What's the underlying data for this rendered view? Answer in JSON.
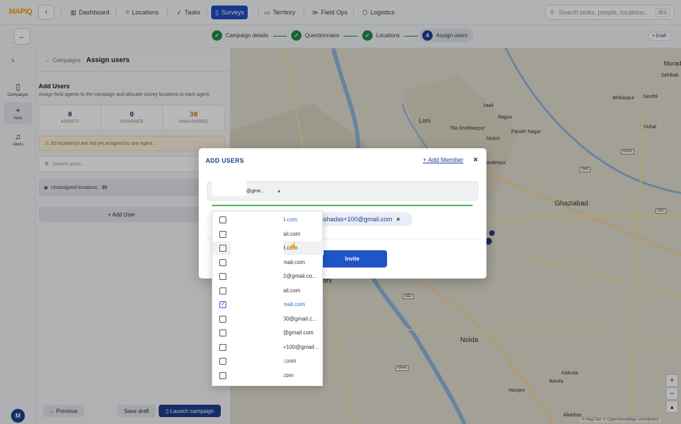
{
  "app": {
    "logo_main": "MAP",
    "logo_accent": "IQ"
  },
  "nav": {
    "items": [
      {
        "label": "Dashboard",
        "icon": "bar-chart-icon"
      },
      {
        "label": "Locations",
        "icon": "pin-icon"
      },
      {
        "label": "Tasks",
        "icon": "check-icon"
      },
      {
        "label": "Surveys",
        "icon": "clipboard-icon",
        "active": true
      },
      {
        "label": "Territory",
        "icon": "map-icon"
      },
      {
        "label": "Field Ops",
        "icon": "route-icon"
      },
      {
        "label": "Logistics",
        "icon": "box-icon"
      }
    ],
    "search_placeholder": "Search tasks, people, locations...",
    "search_shortcut": "⌘K"
  },
  "stepper": {
    "steps": [
      {
        "label": "Campaign details",
        "state": "done",
        "marker": "✓"
      },
      {
        "label": "Questionnaire",
        "state": "done",
        "marker": "✓"
      },
      {
        "label": "Locations",
        "state": "done",
        "marker": "✓"
      },
      {
        "label": "Assign users",
        "state": "current",
        "marker": "4"
      }
    ],
    "status_badge": "• Draft"
  },
  "rail": {
    "items": [
      {
        "label": "Campaigns",
        "icon": "clipboard-icon"
      },
      {
        "label": "New",
        "icon": "plus-icon"
      },
      {
        "label": "Alerts",
        "icon": "bell-icon"
      }
    ],
    "avatar": "M"
  },
  "panel": {
    "breadcrumb": "← Campaigns",
    "title": "Assign users",
    "section_title": "Add Users",
    "section_subtitle": "Assign field agents to the campaign and allocate survey locations to each agent.",
    "stats": [
      {
        "value": "0",
        "label": "AGENTS"
      },
      {
        "value": "0",
        "label": "ASSIGNED"
      },
      {
        "value": "30",
        "label": "UNASSIGNED"
      }
    ],
    "warning": "⚠ 30 location(s) are not yet assigned to any agent.",
    "user_search_placeholder": "Search users...",
    "unassigned_label": "Unassigned locations:",
    "unassigned_count": "30",
    "add_user": "+ Add User",
    "footer": {
      "previous": "← Previous",
      "save_draft": "Save draft",
      "launch": "▯ Launch campaign"
    }
  },
  "map": {
    "labels": [
      "Murad",
      "Sahibab",
      "Bhikanpur",
      "Santhli",
      "Duhai",
      "Loni",
      "Jawli",
      "Rajpur",
      "Tila Shahbazpur",
      "Farukh Nagar",
      "Nistoli",
      "Ghaziabad",
      "Delhi",
      "Noida",
      "Kakraia",
      "Barola",
      "Hazipur",
      "Allahbas",
      "anderpur"
    ],
    "shields": [
      "NH34",
      "NH9",
      "NE3",
      "NE3",
      "NH44"
    ],
    "attribution": "© MapTiler © OpenStreetMap contributors",
    "zoom_in": "+",
    "zoom_out": "−",
    "compass": "▲"
  },
  "modal": {
    "title": "ADD USERS",
    "add_member": "+ Add Member",
    "close": "×",
    "combo_text": "@gme...",
    "combo_caret": "▲",
    "chip_text": "pshadas+100@gmail.com",
    "chip_remove": "×",
    "invite_label": "Invite"
  },
  "dropdown": {
    "items": [
      {
        "text": "il.com",
        "checked": false,
        "blue": true
      },
      {
        "text": "ail.com",
        "checked": false
      },
      {
        "text": "il.com",
        "checked": false,
        "hover": true
      },
      {
        "text": "mail.com",
        "checked": false
      },
      {
        "text": "2@gmail.co...",
        "checked": false
      },
      {
        "text": "ail.com",
        "checked": false
      },
      {
        "text": "mail.com",
        "checked": true,
        "blue": true
      },
      {
        "text": "00@gmail.c...",
        "checked": false
      },
      {
        "text": "@gmail.com",
        "checked": false
      },
      {
        "text": "+100@gmail...",
        "checked": false
      },
      {
        "text": "l.com",
        "checked": false
      },
      {
        "text": "com",
        "checked": false
      }
    ]
  }
}
